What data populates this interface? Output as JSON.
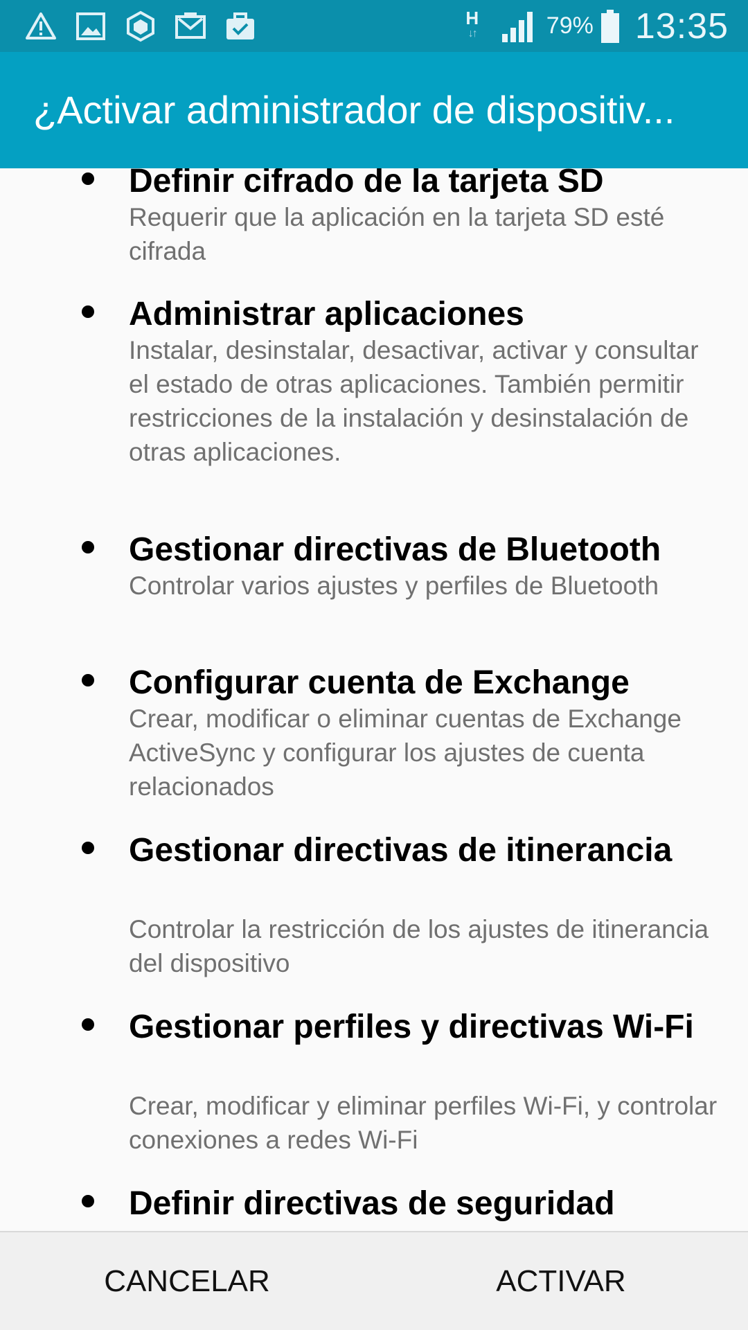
{
  "status_bar": {
    "left_icons": [
      "warning-icon",
      "gallery-icon",
      "vpn-icon",
      "email-icon",
      "briefcase-icon"
    ],
    "network_type": "H",
    "battery_percent": "79%",
    "time": "13:35",
    "colors": {
      "background": "#0b8fab"
    }
  },
  "dialog": {
    "title": "¿Activar administrador de dispositiv...",
    "colors": {
      "title_background": "#04a0c2",
      "title_text": "#ffffff"
    },
    "permissions": [
      {
        "title": "Definir cifrado de la tarjeta SD",
        "description": "Requerir que la aplicación en la tarjeta SD esté cifrada"
      },
      {
        "title": "Administrar aplicaciones",
        "description": "Instalar, desinstalar, desactivar, activar y consultar el estado de otras aplicaciones. También permitir restricciones de la instalación y desinstalación de otras aplicaciones."
      },
      {
        "title": "Gestionar directivas de Bluetooth",
        "description": "Controlar varios ajustes y perfiles de Bluetooth"
      },
      {
        "title": "Configurar cuenta de Exchange",
        "description": "Crear, modificar o eliminar cuentas de Exchange ActiveSync y configurar los ajustes de cuenta relacionados"
      },
      {
        "title": "Gestionar directivas de itinerancia",
        "description": "Controlar la restricción de los ajustes de itinerancia del dispositivo"
      },
      {
        "title": "Gestionar perfiles y directivas Wi-Fi",
        "description": "Crear, modificar y eliminar perfiles Wi-Fi, y controlar conexiones a redes Wi-Fi"
      },
      {
        "title": "Definir directivas de seguridad",
        "description": ""
      }
    ],
    "buttons": {
      "cancel": "CANCELAR",
      "activate": "ACTIVAR"
    }
  }
}
